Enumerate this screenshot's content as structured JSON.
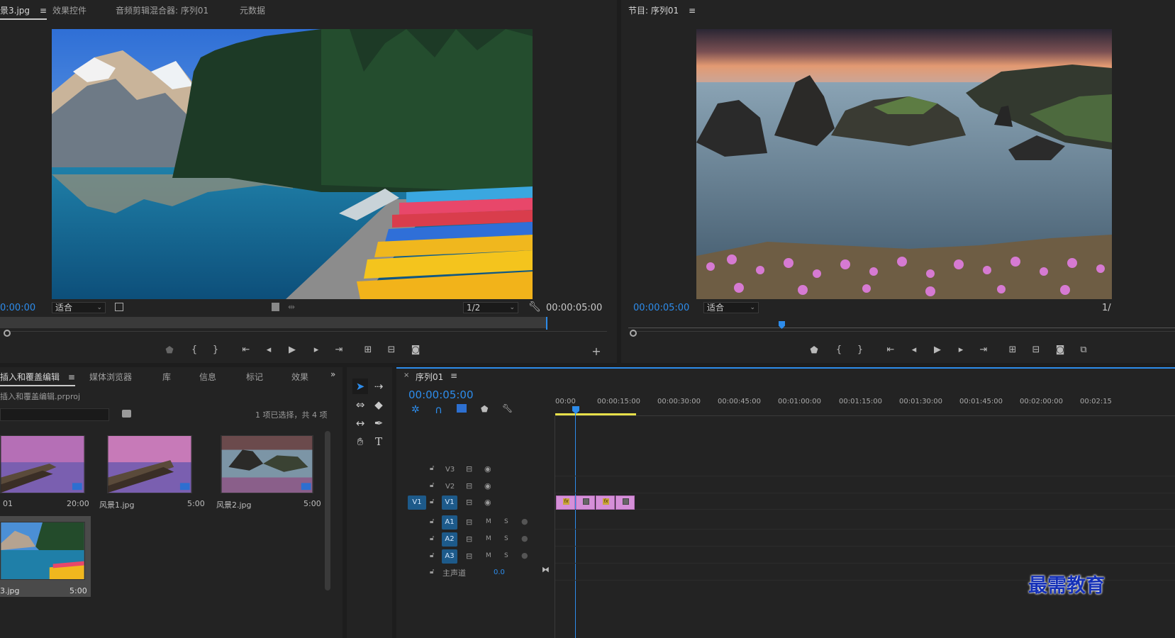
{
  "source_panel": {
    "tabs": [
      "景3.jpg",
      "效果控件",
      "音频剪辑混合器: 序列01",
      "元数据"
    ],
    "timecode_left": "0:00:00",
    "fit": "适合",
    "resolution": "1/2",
    "timecode_right": "00:00:05:00"
  },
  "program_panel": {
    "title": "节目: 序列01",
    "timecode": "00:00:05:00",
    "fit": "适合",
    "resolution": "1/"
  },
  "project_panel": {
    "tabs": [
      "插入和覆盖编辑",
      "媒体浏览器",
      "库",
      "信息",
      "标记",
      "效果"
    ],
    "project_file": "插入和覆盖编辑.prproj",
    "selection_info": "1 项已选择，共 4 项",
    "items": [
      {
        "name": "01",
        "duration": "20:00"
      },
      {
        "name": "风景1.jpg",
        "duration": "5:00"
      },
      {
        "name": "风景2.jpg",
        "duration": "5:00"
      },
      {
        "name": "3.jpg",
        "duration": "5:00"
      }
    ]
  },
  "timeline": {
    "sequence_tab": "序列01",
    "timecode": "00:00:05:00",
    "ticks": [
      "00:00",
      "00:00:15:00",
      "00:00:30:00",
      "00:00:45:00",
      "00:01:00:00",
      "00:01:15:00",
      "00:01:30:00",
      "00:01:45:00",
      "00:02:00:00",
      "00:02:15"
    ],
    "video_tracks": [
      "V3",
      "V2",
      "V1"
    ],
    "source_patch": "V1",
    "audio_tracks": [
      "A1",
      "A2",
      "A3"
    ],
    "mute": "M",
    "solo": "S",
    "master_label": "主声道",
    "master_value": "0.0"
  },
  "watermark": "最需教育",
  "colors": {
    "accent": "#2d8ceb",
    "clip": "#d58fd8",
    "playhead": "#2d8ceb"
  }
}
